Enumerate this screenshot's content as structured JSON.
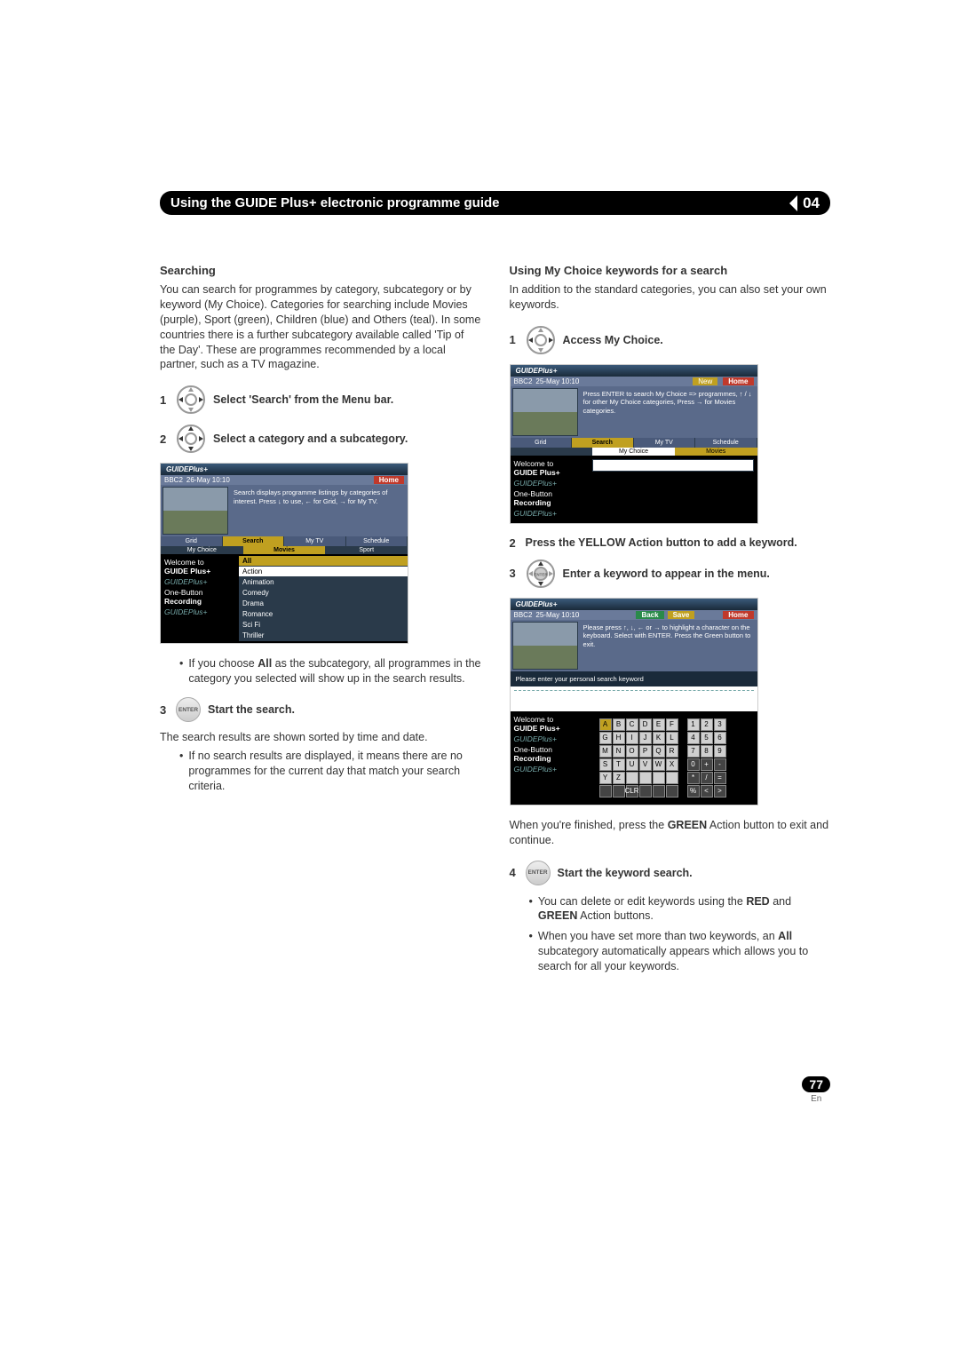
{
  "header": {
    "title": "Using the GUIDE Plus+ electronic programme guide",
    "chapter": "04"
  },
  "left": {
    "searching_title": "Searching",
    "searching_para": "You can search for programmes by category, subcategory or by keyword (My Choice). Categories for searching include Movies (purple), Sport (green), Children (blue) and Others (teal). In some countries there is a further subcategory available called 'Tip of the Day'. These are programmes recommended by a local partner, such as a TV magazine.",
    "step1": "Select 'Search' from the Menu bar.",
    "step2": "Select a category and a subcategory.",
    "ss1": {
      "logo": "GUIDEPlus+",
      "bar_channel": "BBC2",
      "bar_date": "26-May 10:10",
      "bar_home": "Home",
      "desc": "Search displays programme listings by categories of interest. Press ↓ to use, ← for Grid, → for My TV.",
      "tabs": [
        "Grid",
        "Search",
        "My TV",
        "Schedule"
      ],
      "sub_left": "My Choice",
      "sub_mid": "Movies",
      "sub_right": "Sport",
      "side_welcome": "Welcome to",
      "side_gp": "GUIDE Plus+",
      "side_ob": "One-Button",
      "side_rec": "Recording",
      "categories": [
        "All",
        "Action",
        "Animation",
        "Comedy",
        "Drama",
        "Romance",
        "Sci Fi",
        "Thriller"
      ]
    },
    "bullet_all": "If you choose All as the subcategory, all programmes in the category you selected will show up in the search results.",
    "step3_label": "Start the search.",
    "step3_sub": "The search results are shown sorted by time and date.",
    "bullet_noresult": "If no search results are displayed, it means there are no programmes for the current day that match your search criteria."
  },
  "right": {
    "title": "Using My Choice keywords for a search",
    "para": "In addition to the standard categories, you can also set your own keywords.",
    "step1": "Access My Choice.",
    "ss2": {
      "logo": "GUIDEPlus+",
      "bar_channel": "BBC2",
      "bar_date": "25-May 10:10",
      "bar_home": "Home",
      "desc": "Press ENTER to search My Choice => programmes, ↑ / ↓ for other My Choice categories, Press → for Movies categories.",
      "tabs": [
        "Grid",
        "Search",
        "My TV",
        "Schedule"
      ],
      "sub_mid": "My Choice",
      "sub_right": "Movies",
      "side_welcome": "Welcome to",
      "side_gp": "GUIDE Plus+",
      "side_ob": "One-Button",
      "side_rec": "Recording"
    },
    "step2": "Press the YELLOW Action button to add a keyword.",
    "step3": "Enter a keyword to appear in the menu.",
    "ss3": {
      "logo": "GUIDEPlus+",
      "bar_channel": "BBC2",
      "bar_date": "25-May 10:10",
      "back": "Back",
      "save": "Save",
      "bar_home": "Home",
      "desc": "Please press ↑, ↓, ← or → to highlight a character on the keyboard. Select with ENTER. Press the Green button to exit.",
      "prompt": "Please enter your personal search keyword",
      "side_welcome": "Welcome to",
      "side_gp": "GUIDE Plus+",
      "side_ob": "One-Button",
      "side_rec": "Recording",
      "alpha": [
        "A",
        "B",
        "C",
        "D",
        "E",
        "F",
        "G",
        "H",
        "I",
        "J",
        "K",
        "L",
        "M",
        "N",
        "O",
        "P",
        "Q",
        "R",
        "S",
        "T",
        "U",
        "V",
        "W",
        "X",
        "Y",
        "Z",
        " ",
        " ",
        " ",
        " ",
        " ",
        " ",
        "CLR",
        " ",
        " ",
        " "
      ],
      "num": [
        "1",
        "2",
        "3",
        "4",
        "5",
        "6",
        "7",
        "8",
        "9",
        "0",
        "+",
        "-",
        "*",
        "/",
        "=",
        "%",
        "<",
        ">"
      ]
    },
    "after_ss3": "When you're finished, press the GREEN Action button to exit and continue.",
    "step4": "Start the keyword search.",
    "bullet4a_pre": "You can delete or edit keywords using the ",
    "bullet4a_red": "RED",
    "bullet4a_mid": " and ",
    "bullet4a_green": "GREEN",
    "bullet4a_post": " Action buttons.",
    "bullet4b": "When you have set more than two keywords, an All subcategory automatically appears which allows you to search for all your keywords."
  },
  "footer": {
    "page": "77",
    "lang": "En"
  }
}
